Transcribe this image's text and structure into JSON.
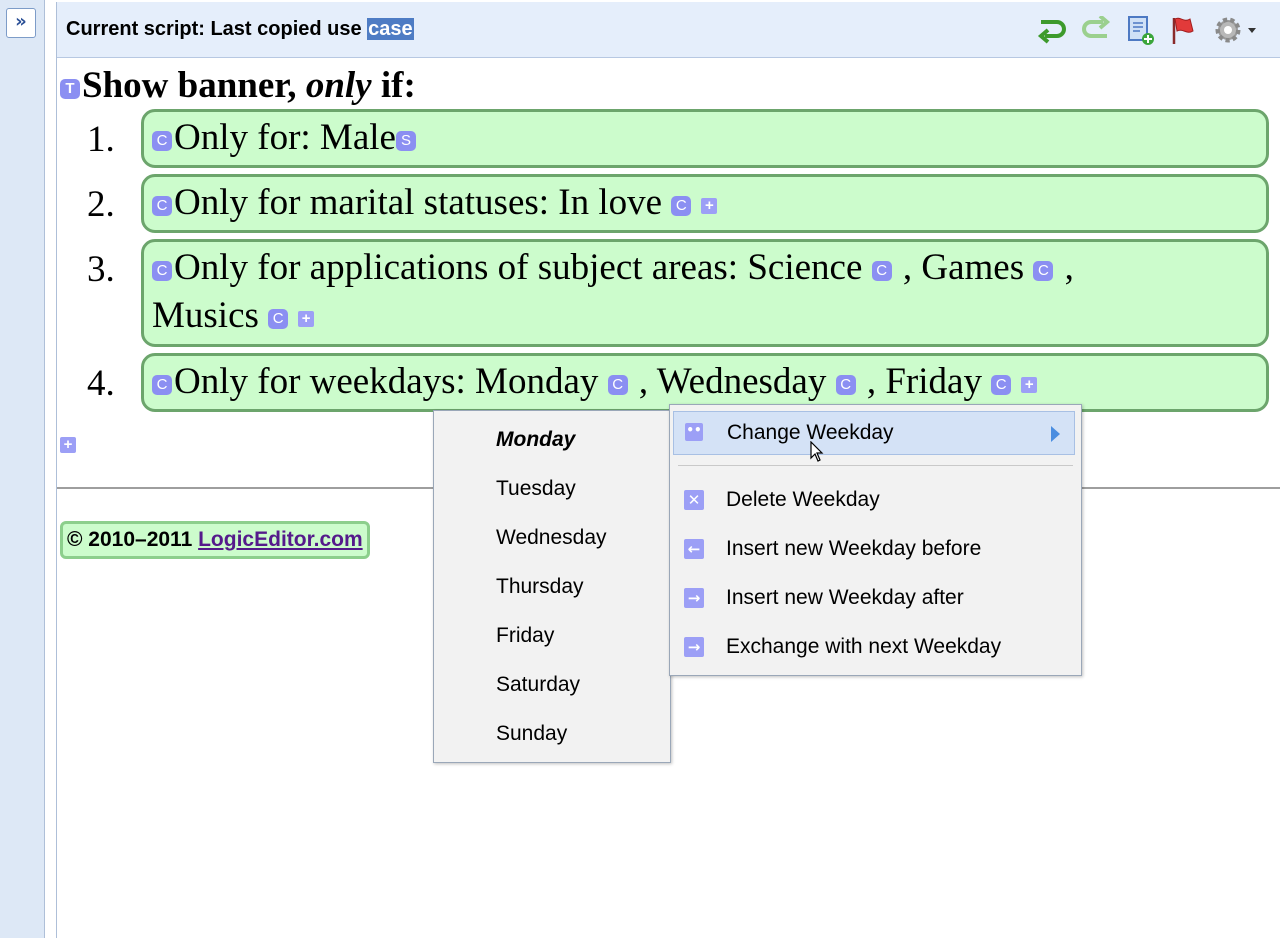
{
  "sidebar": {
    "expand_icon": "double-chevron-right-icon",
    "expand_glyph": "»"
  },
  "header": {
    "title_prefix": "Current script: Last copied use ",
    "title_highlight": "case",
    "toolbar_icons": [
      "undo-icon",
      "redo-icon",
      "new-script-icon",
      "flag-icon",
      "settings-gear-icon"
    ]
  },
  "editor": {
    "title_badge": "T",
    "heading_start": "Show banner, ",
    "heading_em": "only",
    "heading_end": " if:",
    "badge_c": "C",
    "badge_s": "S",
    "plus_glyph": "+",
    "conditions": [
      {
        "number": "1.",
        "text": "Only for: Male"
      },
      {
        "number": "2.",
        "text": "Only for marital statuses: In love"
      },
      {
        "number": "3.",
        "text_start": "Only for applications of subject areas: Science",
        "text_mid": " , Games",
        "text_end": " ,",
        "text_line2": "Musics"
      },
      {
        "number": "4.",
        "text_start": "Only for weekdays: Monday",
        "text_mid": " , Wednesday",
        "text_end": " , Friday"
      }
    ]
  },
  "footer": {
    "copyright": "© 2010–2011 ",
    "link_text": "LogicEditor.com"
  },
  "submenu": {
    "items": [
      "Monday",
      "Tuesday",
      "Wednesday",
      "Thursday",
      "Friday",
      "Saturday",
      "Sunday"
    ],
    "selected": "Monday"
  },
  "context_menu": {
    "items": [
      {
        "label": "Change Weekday",
        "icon": "change-icon",
        "active": true,
        "has_submenu": true
      },
      {
        "label": "Delete Weekday",
        "icon": "delete-x-icon"
      },
      {
        "label": "Insert new Weekday before",
        "icon": "arrow-left-icon"
      },
      {
        "label": "Insert new Weekday after",
        "icon": "arrow-right-icon"
      },
      {
        "label": "Exchange with next Weekday",
        "icon": "exchange-icon"
      }
    ]
  },
  "colors": {
    "condition_bg": "#ccfccc",
    "condition_border": "#6ca56c",
    "badge": "#8b8ff2",
    "header_bg": "#e5eefb",
    "highlight": "#4e7cc4",
    "menu_active": "#d4e2f6"
  }
}
